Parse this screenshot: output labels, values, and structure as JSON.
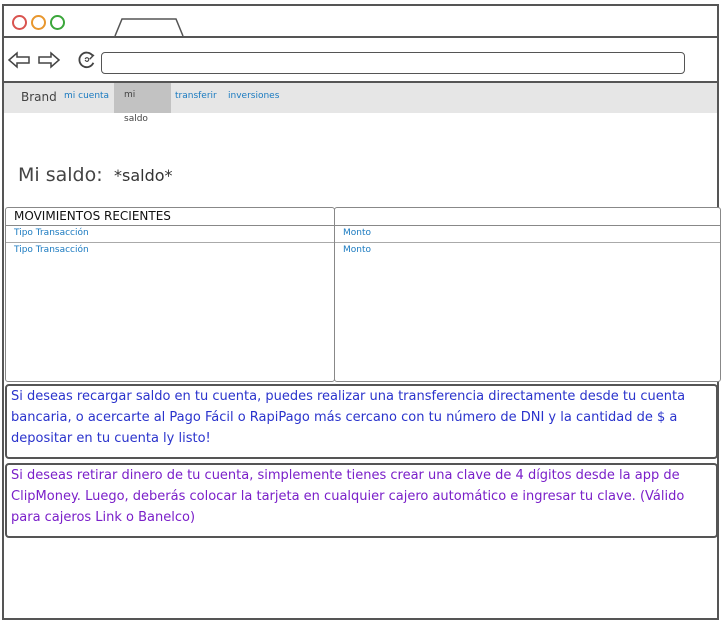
{
  "nav": {
    "brand": "Brand",
    "items": [
      {
        "label": "mi cuenta"
      },
      {
        "label": "mi saldo"
      },
      {
        "label": "transferir"
      },
      {
        "label": "inversiones"
      }
    ]
  },
  "balance": {
    "label": "Mi saldo:",
    "value": "*saldo*"
  },
  "movements": {
    "title": "MOVIMIENTOS RECIENTES",
    "rows_left": [
      "Tipo Transacción",
      "Tipo Transacción"
    ],
    "rows_right": [
      "Monto",
      "Monto"
    ]
  },
  "info": {
    "recharge": "Si deseas recargar saldo en tu cuenta, puedes realizar una transferencia directamente desde tu cuenta bancaria, o acercarte al Pago Fácil o RapiPago más cercano con tu número de DNI y la cantidad de $ a depositar en tu cuenta ly listo!",
    "withdraw": "Si deseas retirar dinero de tu cuenta, simplemente tienes crear una clave de 4 dígitos desde la app de ClipMoney. Luego, deberás colocar la tarjeta en cualquier cajero automático e ingresar tu clave. (Válido para cajeros Link o Banelco)"
  },
  "colors": {
    "link": "#1a7ac0",
    "info_blue": "#2a33cc",
    "info_purple": "#7a1fc9",
    "close_dot": "#d9534f",
    "min_dot": "#e8972e",
    "max_dot": "#3aa63a"
  },
  "icons": [
    "back-arrow-icon",
    "forward-arrow-icon",
    "reload-icon"
  ]
}
